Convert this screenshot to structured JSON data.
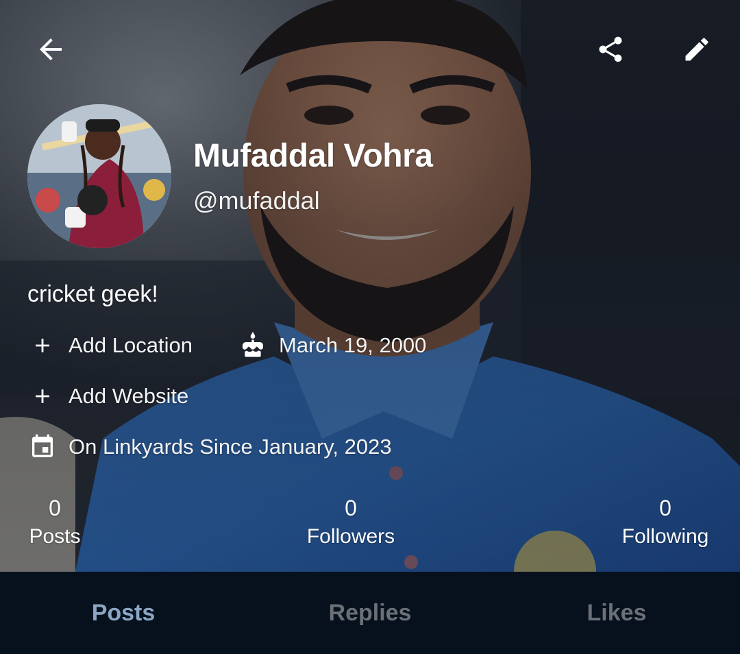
{
  "profile": {
    "display_name": "Mufaddal Vohra",
    "handle": "@mufaddal",
    "bio": "cricket geek!",
    "add_location_label": "Add Location",
    "birthday": "March 19, 2000",
    "add_website_label": "Add Website",
    "joined": "On Linkyards Since January, 2023"
  },
  "stats": [
    {
      "count": "0",
      "label": "Posts"
    },
    {
      "count": "0",
      "label": "Followers"
    },
    {
      "count": "0",
      "label": "Following"
    }
  ],
  "tabs": [
    {
      "label": "Posts",
      "active": true
    },
    {
      "label": "Replies",
      "active": false
    },
    {
      "label": "Likes",
      "active": false
    }
  ],
  "icons": {
    "back": "arrow-left-icon",
    "share": "share-icon",
    "edit": "pencil-icon",
    "location": "plus-icon",
    "birthday": "cake-icon",
    "website": "plus-icon",
    "joined": "calendar-icon"
  },
  "colors": {
    "tab_bar_bg": "#06111d",
    "tab_active": "#8aa6c4",
    "tab_inactive": "#6b6f76",
    "text": "#ffffff"
  }
}
